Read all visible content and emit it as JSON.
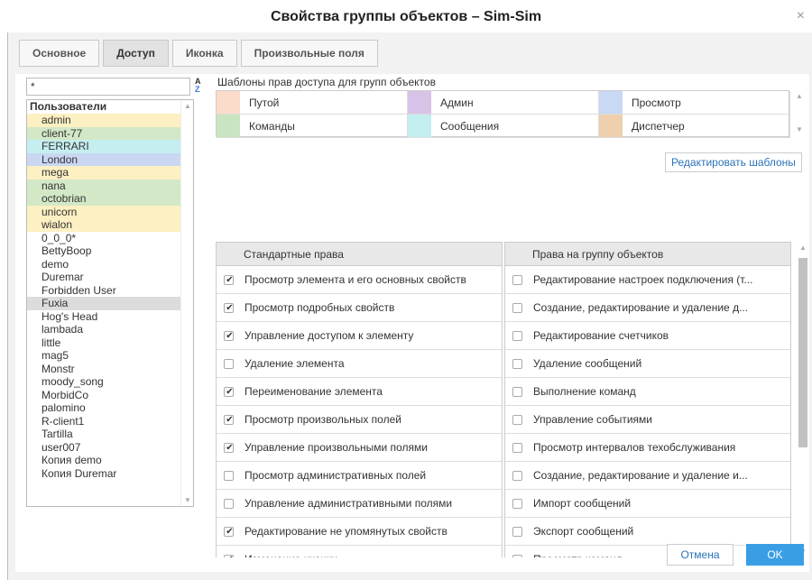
{
  "window": {
    "title": "Свойства группы объектов – Sim-Sim",
    "close": "×"
  },
  "tabs": [
    {
      "label": "Основное"
    },
    {
      "label": "Доступ"
    },
    {
      "label": "Иконка"
    },
    {
      "label": "Произвольные поля"
    }
  ],
  "users": {
    "search_value": "*",
    "header": "Пользователи",
    "items": [
      {
        "name": "admin",
        "color": "#fdf0c2"
      },
      {
        "name": "client-77",
        "color": "#d3e8c7"
      },
      {
        "name": "FERRARI",
        "color": "#c5eef0"
      },
      {
        "name": "London",
        "color": "#c9d7f3"
      },
      {
        "name": "mega",
        "color": "#fdf0c2"
      },
      {
        "name": "nana",
        "color": "#d3e8c7"
      },
      {
        "name": "octobrian",
        "color": "#d3e8c7"
      },
      {
        "name": "unicorn",
        "color": "#fdf0c2"
      },
      {
        "name": "wialon",
        "color": "#fdf0c2"
      },
      {
        "name": "0_0_0*",
        "color": ""
      },
      {
        "name": "BettyBoop",
        "color": ""
      },
      {
        "name": "demo",
        "color": ""
      },
      {
        "name": "Duremar",
        "color": ""
      },
      {
        "name": "Forbidden User",
        "color": ""
      },
      {
        "name": "Fuxia",
        "color": "#dcdcdc"
      },
      {
        "name": "Hog's Head",
        "color": ""
      },
      {
        "name": "lambada",
        "color": ""
      },
      {
        "name": "little",
        "color": ""
      },
      {
        "name": "mag5",
        "color": ""
      },
      {
        "name": "Monstr",
        "color": ""
      },
      {
        "name": "moody_song",
        "color": ""
      },
      {
        "name": "MorbidCo",
        "color": ""
      },
      {
        "name": "palomino",
        "color": ""
      },
      {
        "name": "R-client1",
        "color": ""
      },
      {
        "name": "Tartilla",
        "color": ""
      },
      {
        "name": "user007",
        "color": ""
      },
      {
        "name": "Копия demo",
        "color": ""
      },
      {
        "name": "Копия Duremar",
        "color": ""
      }
    ]
  },
  "templates": {
    "title": "Шаблоны прав доступа для групп объектов",
    "items": [
      {
        "label": "Путой",
        "color": "#fbdccb"
      },
      {
        "label": "Админ",
        "color": "#d8c3e8"
      },
      {
        "label": "Просмотр",
        "color": "#c9d9f3"
      },
      {
        "label": "Команды",
        "color": "#c8e4c0"
      },
      {
        "label": "Сообщения",
        "color": "#c3eef0"
      },
      {
        "label": "Диспетчер",
        "color": "#eecfae"
      }
    ],
    "edit_button": "Редактировать шаблоны"
  },
  "rights": {
    "standard_header": "Стандартные права",
    "group_header": "Права на группу объектов",
    "standard": [
      {
        "label": "Просмотр элемента и его основных свойств",
        "checked": true
      },
      {
        "label": "Просмотр подробных свойств",
        "checked": true
      },
      {
        "label": "Управление доступом к элементу",
        "checked": true
      },
      {
        "label": "Удаление элемента",
        "checked": false
      },
      {
        "label": "Переименование элемента",
        "checked": true
      },
      {
        "label": "Просмотр произвольных полей",
        "checked": true
      },
      {
        "label": "Управление произвольными полями",
        "checked": true
      },
      {
        "label": "Просмотр административных полей",
        "checked": false
      },
      {
        "label": "Управление административными полями",
        "checked": false
      },
      {
        "label": "Редактирование не упомянутых свойств",
        "checked": true
      },
      {
        "label": "Изменение иконки",
        "checked": true
      }
    ],
    "group": [
      {
        "label": "Редактирование настроек подключения (т...",
        "checked": false
      },
      {
        "label": "Создание, редактирование и удаление д...",
        "checked": false
      },
      {
        "label": "Редактирование счетчиков",
        "checked": false
      },
      {
        "label": "Удаление сообщений",
        "checked": false
      },
      {
        "label": "Выполнение команд",
        "checked": false
      },
      {
        "label": "Управление событиями",
        "checked": false
      },
      {
        "label": "Просмотр интервалов техобслуживания",
        "checked": false
      },
      {
        "label": "Создание, редактирование и удаление и...",
        "checked": false
      },
      {
        "label": "Импорт сообщений",
        "checked": false
      },
      {
        "label": "Экспорт сообщений",
        "checked": false
      },
      {
        "label": "Просмотр команд",
        "checked": false
      }
    ]
  },
  "footer": {
    "cancel": "Отмена",
    "ok": "OK"
  }
}
